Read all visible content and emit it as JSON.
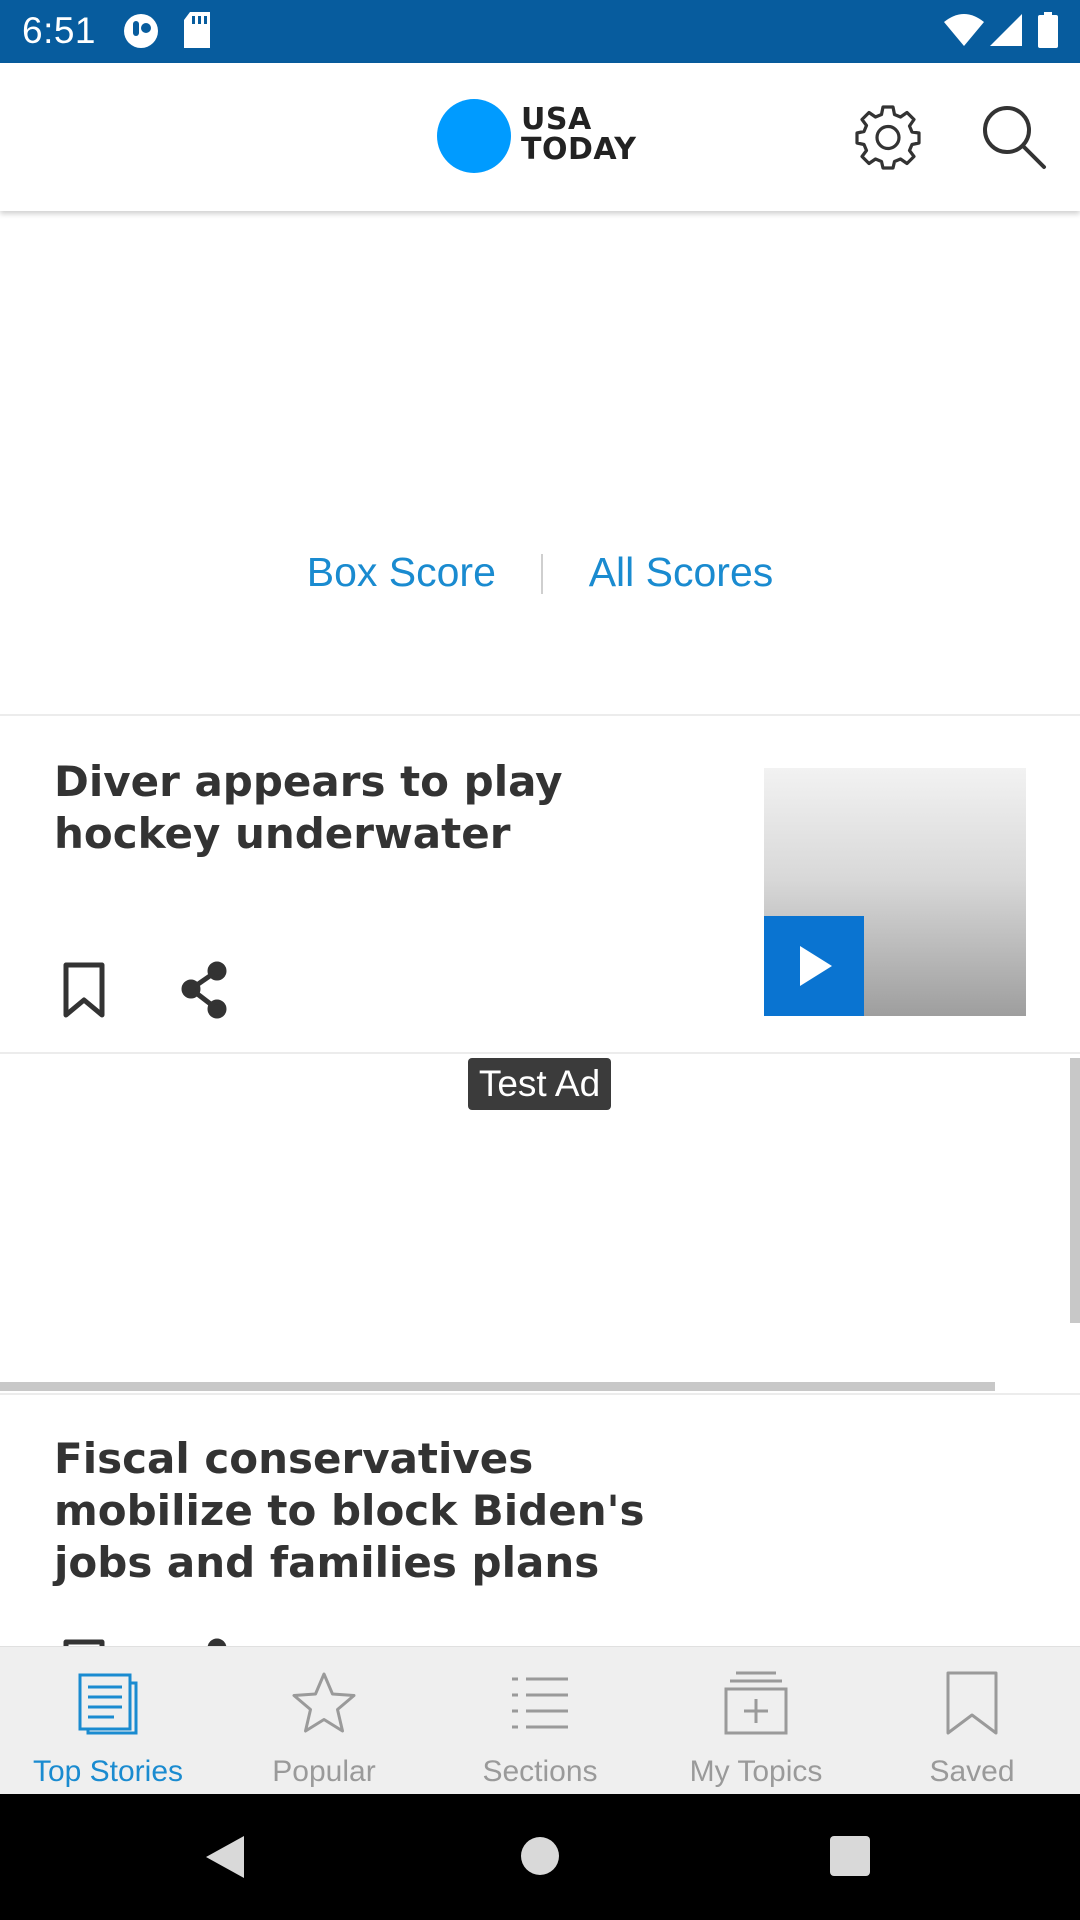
{
  "status_bar": {
    "time": "6:51"
  },
  "header": {
    "logo_line1": "USA",
    "logo_line2": "TODAY"
  },
  "scores": {
    "box_score": "Box Score",
    "all_scores": "All Scores"
  },
  "stories": [
    {
      "title": "Diver appears to play hockey underwater"
    },
    {
      "title": "Fiscal conservatives mobilize to block Biden's jobs and families plans"
    }
  ],
  "ad": {
    "label": "Test Ad"
  },
  "bottom_nav": {
    "items": [
      {
        "label": "Top Stories",
        "icon": "top-stories-icon",
        "active": true
      },
      {
        "label": "Popular",
        "icon": "star-icon"
      },
      {
        "label": "Sections",
        "icon": "list-icon"
      },
      {
        "label": "My Topics",
        "icon": "topics-icon"
      },
      {
        "label": "Saved",
        "icon": "bookmark-icon"
      }
    ]
  },
  "colors": {
    "status_bar": "#075c9e",
    "accent": "#1a8bd0",
    "logo": "#009bff",
    "play": "#0a74d1"
  }
}
